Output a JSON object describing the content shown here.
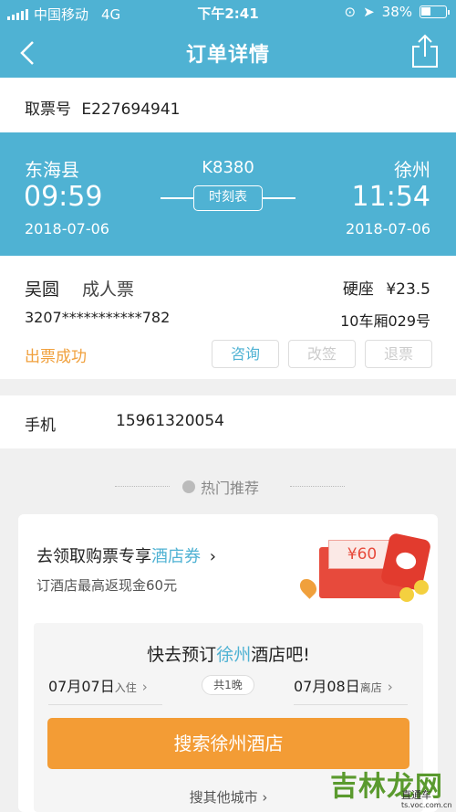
{
  "status_bar": {
    "carrier": "中国移动",
    "network": "4G",
    "time": "下午2:41",
    "battery": "38%"
  },
  "nav": {
    "title": "订单详情",
    "back_icon": "chevron-left-icon",
    "share_icon": "share-icon"
  },
  "ticket": {
    "label": "取票号",
    "number": "E227694941"
  },
  "route": {
    "from_station": "东海县",
    "from_time": "09:59",
    "from_date": "2018-07-06",
    "train_no": "K8380",
    "timetable_label": "时刻表",
    "to_station": "徐州",
    "to_time": "11:54",
    "to_date": "2018-07-06"
  },
  "passenger": {
    "name": "吴圆",
    "ticket_type": "成人票",
    "seat_class": "硬座",
    "price": "¥23.5",
    "id_number": "3207***********782",
    "seat_no": "10车厢029号",
    "status": "出票成功",
    "buttons": {
      "consult": "咨询",
      "change": "改签",
      "refund": "退票"
    }
  },
  "contact": {
    "label": "手机",
    "phone": "15961320054"
  },
  "recommend": {
    "header": "热门推荐",
    "promo_prefix": "去领取购票专享",
    "promo_highlight": "酒店券",
    "promo_sub": "订酒店最高返现金60元",
    "coupon_value": "¥60",
    "hotel_title_prefix": "快去预订",
    "hotel_city": "徐州",
    "hotel_title_suffix": "酒店吧!",
    "checkin_date": "07月07日",
    "checkin_label": "入住",
    "checkout_date": "07月08日",
    "checkout_label": "离店",
    "nights": "共1晚",
    "search_button": "搜索徐州酒店",
    "other_city": "搜其他城市"
  },
  "watermark": {
    "text": "吉林龙网",
    "tag": "直通车",
    "url": "ts.voc.com.cn"
  },
  "colors": {
    "primary": "#4fb2d3",
    "orange": "#f39c35",
    "status": "#f0a03c"
  }
}
